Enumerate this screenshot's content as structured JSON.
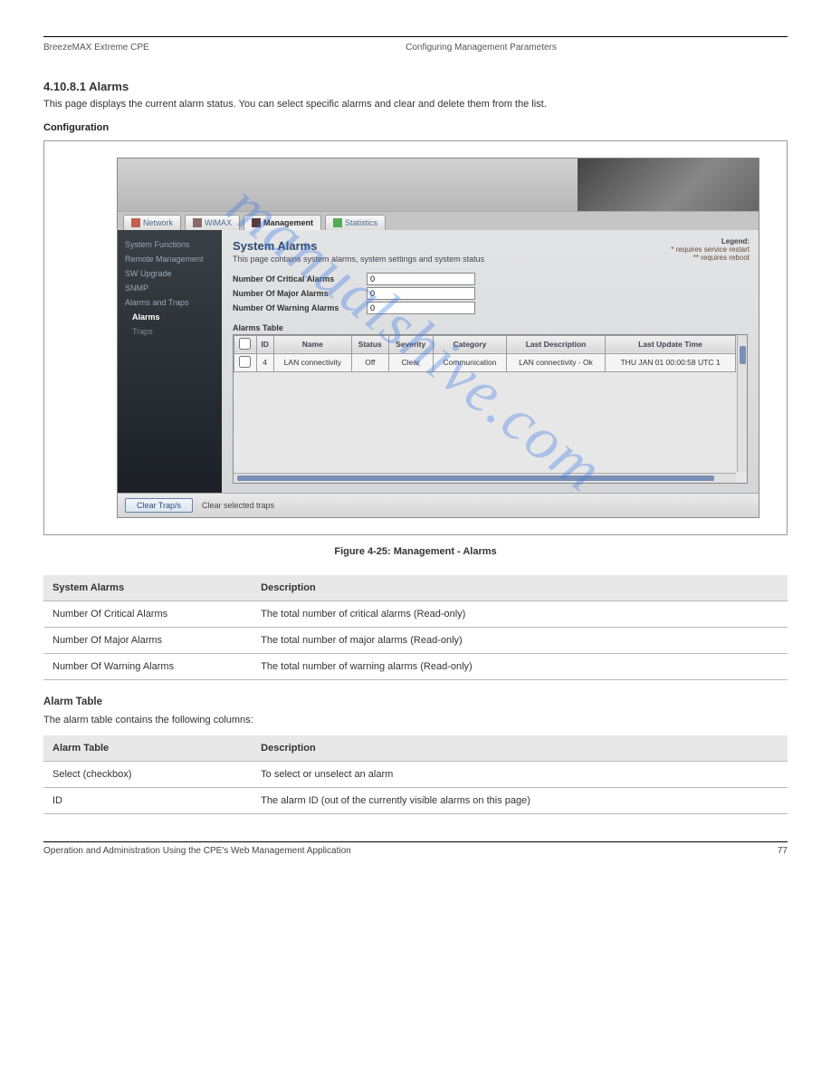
{
  "doc": {
    "product_line": "BreezeMAX Extreme CPE",
    "chapter": "Configuring Management Parameters",
    "sec_num": "4.10.8.1",
    "sec_title": "Alarms",
    "sec_para": "This page displays the current alarm status. You can select specific alarms and clear and delete them from the list.",
    "config_label": "Configuration",
    "fig_caption": "Figure 4-25: Management - Alarms",
    "footer_left": "Operation and Administration Using the CPE's Web Management Application",
    "footer_right": "77",
    "watermark": "manualshive.com"
  },
  "tabs": [
    {
      "label": "Network",
      "icon_color": "#c06050"
    },
    {
      "label": "WiMAX",
      "icon_color": "#8a6a6a"
    },
    {
      "label": "Management",
      "icon_color": "#5a3a3a"
    },
    {
      "label": "Statistics",
      "icon_color": "#55aa55"
    }
  ],
  "active_tab": 2,
  "sidebar": {
    "items": [
      "System Functions",
      "Remote Management",
      "SW Upgrade",
      "SNMP",
      "Alarms and Traps"
    ],
    "sub": {
      "active": "Alarms",
      "other": "Traps"
    }
  },
  "panel": {
    "title": "System Alarms",
    "desc": "This page contains system alarms, system settings and system status",
    "legend_title": "Legend:",
    "legend_a": "* requires service restart",
    "legend_b": "** requires reboot",
    "fields": [
      {
        "label": "Number Of Critical Alarms",
        "value": "0"
      },
      {
        "label": "Number Of Major Alarms",
        "value": "0"
      },
      {
        "label": "Number Of Warning Alarms",
        "value": "0"
      }
    ],
    "table_title": "Alarms Table",
    "columns": [
      "",
      "ID",
      "Name",
      "Status",
      "Severity",
      "Category",
      "Last Description",
      "Last Update Time"
    ],
    "rows": [
      {
        "checked": false,
        "id": "4",
        "name": "LAN connectivity",
        "status": "Off",
        "severity": "Clear",
        "category": "Communication",
        "desc": "LAN connectivity - Ok",
        "time": "THU JAN 01 00:00:58 UTC 1"
      }
    ],
    "action_btn": "Clear Trap/s",
    "action_help": "Clear selected traps"
  },
  "tables": {
    "system_alarms": {
      "header": [
        "System Alarms",
        "Description"
      ],
      "rows": [
        [
          "Number Of Critical Alarms",
          "The total number of critical alarms (Read-only)"
        ],
        [
          "Number Of Major Alarms",
          "The total number of major alarms (Read-only)"
        ],
        [
          "Number Of Warning Alarms",
          "The total number of warning alarms (Read-only)"
        ]
      ]
    },
    "alarm_table_subhead": "Alarm Table",
    "alarm_table_intro": "The alarm table contains the following columns:",
    "alarm_table": {
      "header": [
        "Alarm Table",
        "Description"
      ],
      "rows": [
        [
          "Select (checkbox)",
          "To select or unselect an alarm"
        ],
        [
          "ID",
          "The alarm ID (out of the currently visible alarms on this page)"
        ]
      ]
    }
  }
}
